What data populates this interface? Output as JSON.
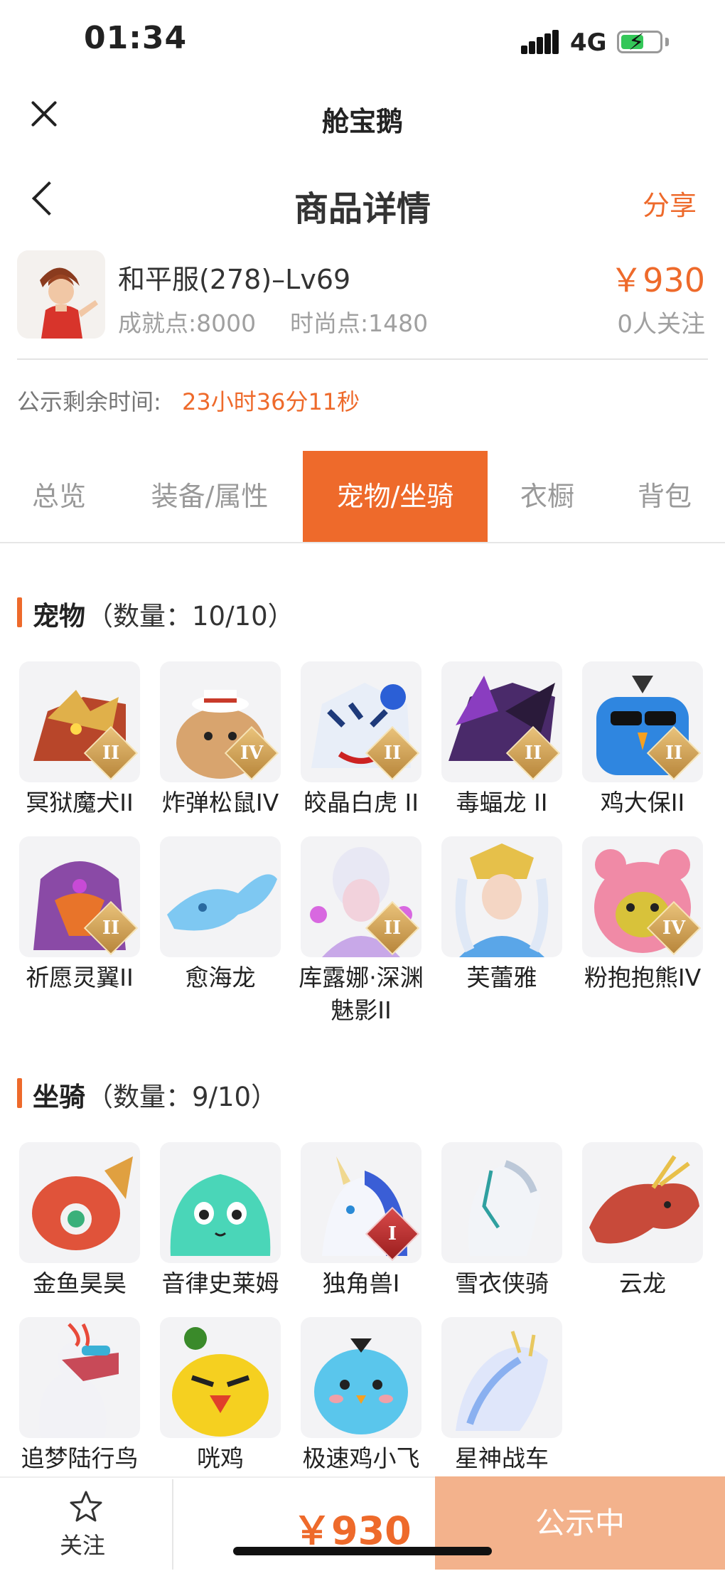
{
  "status_bar": {
    "time": "01:34",
    "network": "4G",
    "battery_level": 0.6
  },
  "app": {
    "title": "舱宝鹅"
  },
  "header": {
    "title": "商品详情",
    "share_label": "分享"
  },
  "product": {
    "name": "和平服(278)–Lv69",
    "achievement": "成就点:8000",
    "fashion": "时尚点:1480",
    "price": "￥930",
    "followers": "0人关注"
  },
  "remaining": {
    "label": "公示剩余时间:",
    "value": "23小时36分11秒"
  },
  "tabs": [
    {
      "label": "总览",
      "active": false
    },
    {
      "label": "装备/属性",
      "active": false
    },
    {
      "label": "宠物/坐骑",
      "active": true
    },
    {
      "label": "衣橱",
      "active": false
    },
    {
      "label": "背包",
      "active": false
    }
  ],
  "pets": {
    "title": "宠物",
    "count": "（数量：10/10）",
    "items": [
      {
        "name": "冥狱魔犬II",
        "badge": "II",
        "icon": "dragon-hound-icon"
      },
      {
        "name": "炸弹松鼠IV",
        "badge": "IV",
        "icon": "squirrel-icon"
      },
      {
        "name": "皎晶白虎 II",
        "badge": "II",
        "icon": "white-tiger-icon"
      },
      {
        "name": "毒蝠龙 II",
        "badge": "II",
        "icon": "bat-dragon-icon"
      },
      {
        "name": "鸡大保II",
        "badge": "II",
        "icon": "chicken-boss-icon"
      },
      {
        "name": "祈愿灵翼II",
        "badge": "II",
        "icon": "bird-wing-icon"
      },
      {
        "name": "愈海龙",
        "badge": "",
        "icon": "sea-dragon-icon"
      },
      {
        "name": "库露娜·深渊魅影II",
        "badge": "II",
        "icon": "abyss-girl-icon"
      },
      {
        "name": "芙蕾雅",
        "badge": "",
        "icon": "valkyrie-icon"
      },
      {
        "name": "粉抱抱熊IV",
        "badge": "IV",
        "icon": "pink-bear-icon"
      }
    ]
  },
  "mounts": {
    "title": "坐骑",
    "count": "（数量：9/10）",
    "items": [
      {
        "name": "金鱼昊昊",
        "badge": "",
        "icon": "goldfish-icon"
      },
      {
        "name": "音律史莱姆",
        "badge": "",
        "icon": "slime-icon"
      },
      {
        "name": "独角兽I",
        "badge": "I",
        "icon": "unicorn-icon"
      },
      {
        "name": "雪衣侠骑",
        "badge": "",
        "icon": "white-horse-icon"
      },
      {
        "name": "云龙",
        "badge": "",
        "icon": "cloud-dragon-icon"
      },
      {
        "name": "追梦陆行鸟",
        "badge": "",
        "icon": "ostrich-icon"
      },
      {
        "name": "咣鸡",
        "badge": "",
        "icon": "yellow-chicken-icon"
      },
      {
        "name": "极速鸡小飞",
        "badge": "",
        "icon": "blue-chick-icon"
      },
      {
        "name": "星神战车",
        "badge": "",
        "icon": "spirit-horse-icon"
      }
    ]
  },
  "bottom": {
    "follow_label": "关注",
    "price": "￥930",
    "status_label": "公示中"
  },
  "colors": {
    "accent": "#ee6a2b",
    "accent_light": "#f3b28c",
    "muted": "#a0a0a0"
  }
}
